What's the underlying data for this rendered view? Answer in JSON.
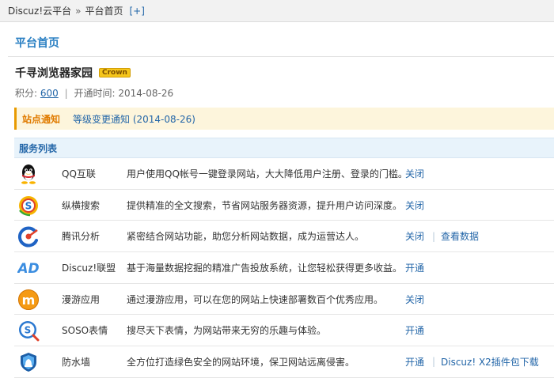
{
  "breadcrumb": {
    "root": "Discuz!云平台",
    "separator": "»",
    "current": "平台首页",
    "add": "[+]"
  },
  "page_title": "平台首页",
  "site": {
    "name": "千寻浏览器家园",
    "badge": "Crown"
  },
  "meta": {
    "score_label": "积分:",
    "score": "600",
    "divider": "|",
    "open_label": "开通时间:",
    "open_date": "2014-08-26"
  },
  "notice": {
    "label": "站点通知",
    "text": "等级变更通知 (2014-08-26)"
  },
  "services_title": "服务列表",
  "services": [
    {
      "icon": "qq-penguin-icon",
      "name": "QQ互联",
      "desc": "用户使用QQ帐号一键登录网站，大大降低用户注册、登录的门槛。",
      "action": "关闭",
      "extra": ""
    },
    {
      "icon": "soso-search-icon",
      "name": "纵横搜索",
      "desc": "提供精准的全文搜索，节省网站服务器资源，提升用户访问深度。",
      "action": "关闭",
      "extra": ""
    },
    {
      "icon": "tencent-analytics-icon",
      "name": "腾讯分析",
      "desc": "紧密结合网站功能，助您分析网站数据，成为运营达人。",
      "action": "关闭",
      "extra": "查看数据"
    },
    {
      "icon": "ad-union-icon",
      "name": "Discuz!联盟",
      "desc": "基于海量数据挖掘的精准广告投放系统，让您轻松获得更多收益。",
      "action": "开通",
      "extra": ""
    },
    {
      "icon": "manyou-icon",
      "name": "漫游应用",
      "desc": "通过漫游应用，可以在您的网站上快速部署数百个优秀应用。",
      "action": "关闭",
      "extra": ""
    },
    {
      "icon": "soso-emoticon-icon",
      "name": "SOSO表情",
      "desc": "搜尽天下表情，为网站带来无穷的乐趣与体验。",
      "action": "开通",
      "extra": ""
    },
    {
      "icon": "firewall-shield-icon",
      "name": "防水墙",
      "desc": "全方位打造绿色安全的网站环境，保卫网站远离侵害。",
      "action": "开通",
      "extra": "Discuz! X2插件包下载"
    }
  ]
}
